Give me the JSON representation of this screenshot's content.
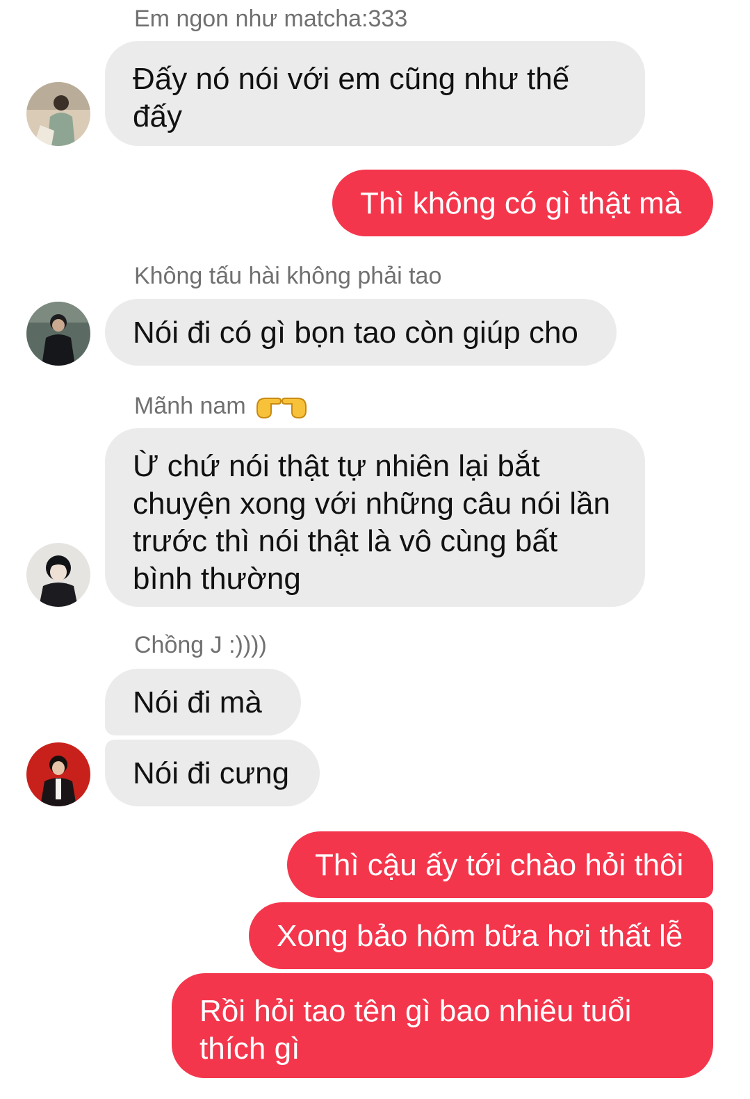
{
  "colors": {
    "incoming_bubble": "#ebebeb",
    "outgoing_bubble": "#f4364c",
    "sender_name": "#707070"
  },
  "conversation": {
    "groups": [
      {
        "sender": "Em ngon như matcha:333",
        "avatar_icon": "avatar-photo",
        "messages": [
          "Đấy nó nói với em cũng như thế đấy"
        ]
      },
      {
        "sender": "",
        "outgoing": true,
        "messages": [
          "Thì không có gì thật mà"
        ]
      },
      {
        "sender": "Không tấu hài không phải tao",
        "avatar_icon": "avatar-photo",
        "messages": [
          "Nói đi có gì bọn tao còn giúp cho"
        ]
      },
      {
        "sender": "Mãnh nam",
        "sender_emoji": "pointing-hands-icon",
        "avatar_icon": "avatar-photo",
        "messages": [
          "Ừ chứ nói thật tự nhiên lại bắt chuyện xong với những câu nói lần trước thì nói thật là vô cùng bất bình thường"
        ]
      },
      {
        "sender": "Chồng J :))))",
        "avatar_icon": "avatar-photo",
        "messages": [
          "Nói đi mà",
          "Nói đi cưng"
        ]
      },
      {
        "sender": "",
        "outgoing": true,
        "messages": [
          "Thì cậu ấy tới chào hỏi thôi",
          "Xong bảo hôm bữa hơi thất lễ",
          "Rồi hỏi tao tên gì bao nhiêu tuổi thích gì"
        ]
      }
    ]
  }
}
